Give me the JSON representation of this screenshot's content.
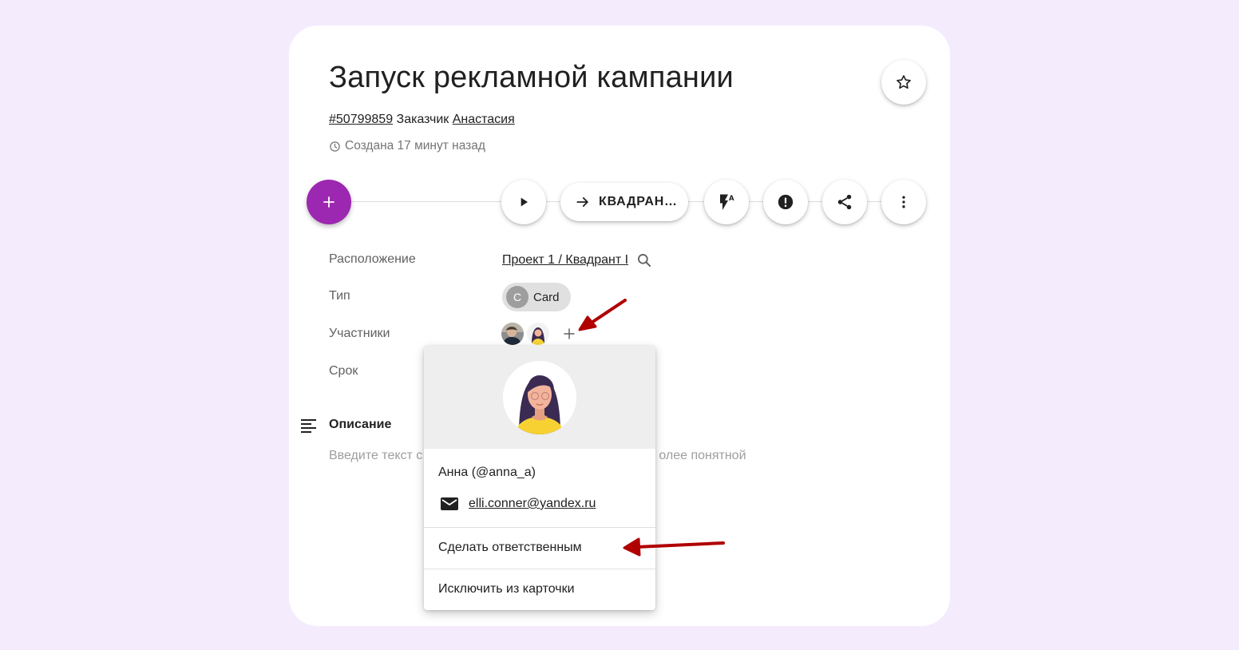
{
  "card": {
    "title": "Запуск рекламной кампании",
    "id_link": "#50799859",
    "customer_label": "Заказчик",
    "customer_name": "Анастасия",
    "created": "Создана 17 минут назад"
  },
  "toolbar": {
    "add_icon": "plus-icon",
    "play_icon": "play-icon",
    "move_label": "КВАДРАН…",
    "automation_icon": "flash-auto-icon",
    "priority_icon": "alert-circle-icon",
    "share_icon": "share-icon",
    "more_icon": "more-vertical-icon"
  },
  "fields": {
    "location_label": "Расположение",
    "location_value": "Проект 1 / Квадрант I",
    "type_label": "Тип",
    "type_chip_letter": "C",
    "type_chip_value": "Card",
    "members_label": "Участники",
    "deadline_label": "Срок"
  },
  "description": {
    "label": "Описание",
    "placeholder_left": "Введите текст с",
    "placeholder_right": "олее понятной"
  },
  "member_popup": {
    "name": "Анна (@anna_a)",
    "email": "elli.conner@yandex.ru",
    "make_responsible": "Сделать ответственным",
    "remove_from_card": "Исключить из карточки"
  },
  "colors": {
    "background": "#f4ebfd",
    "fab": "#9c27b0",
    "annotation_arrow": "#b00000"
  }
}
